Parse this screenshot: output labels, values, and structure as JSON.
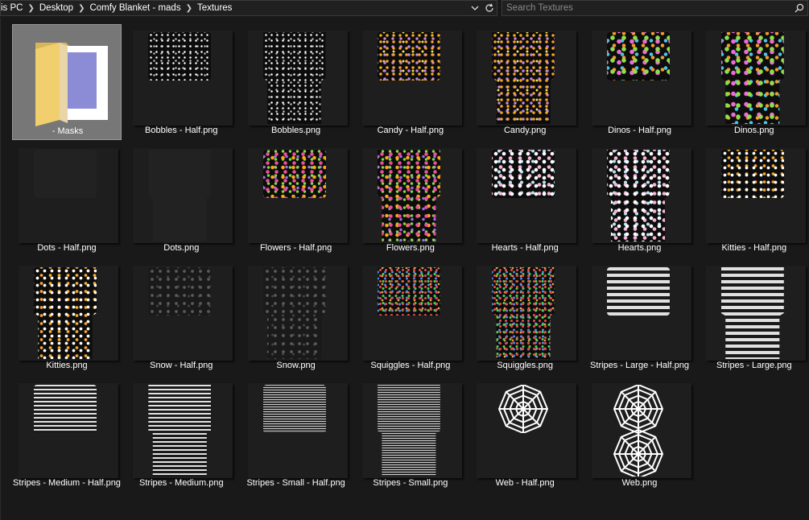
{
  "breadcrumb": [
    "is PC",
    "Desktop",
    "Comfy Blanket - mads",
    "Textures"
  ],
  "search": {
    "placeholder": "Search Textures"
  },
  "colors": {
    "background": "#191919",
    "selected_tile": "#777777",
    "text": "#ffffff"
  },
  "files": [
    {
      "name": "- Masks",
      "kind": "folder",
      "selected": true
    },
    {
      "name": "Bobbles - Half.png",
      "pattern": "bobbles",
      "shape": "half"
    },
    {
      "name": "Bobbles.png",
      "pattern": "bobbles",
      "shape": "full"
    },
    {
      "name": "Candy - Half.png",
      "pattern": "candy",
      "shape": "half"
    },
    {
      "name": "Candy.png",
      "pattern": "candy",
      "shape": "full"
    },
    {
      "name": "Dinos - Half.png",
      "pattern": "dinos",
      "shape": "half"
    },
    {
      "name": "Dinos.png",
      "pattern": "dinos",
      "shape": "full"
    },
    {
      "name": "Dots - Half.png",
      "pattern": "dots",
      "shape": "half"
    },
    {
      "name": "Dots.png",
      "pattern": "dots",
      "shape": "full"
    },
    {
      "name": "Flowers - Half.png",
      "pattern": "flowers",
      "shape": "half"
    },
    {
      "name": "Flowers.png",
      "pattern": "flowers",
      "shape": "full"
    },
    {
      "name": "Hearts - Half.png",
      "pattern": "hearts",
      "shape": "half"
    },
    {
      "name": "Hearts.png",
      "pattern": "hearts",
      "shape": "full"
    },
    {
      "name": "Kitties - Half.png",
      "pattern": "kitties",
      "shape": "half"
    },
    {
      "name": "Kitties.png",
      "pattern": "kitties",
      "shape": "full"
    },
    {
      "name": "Snow - Half.png",
      "pattern": "snow",
      "shape": "half"
    },
    {
      "name": "Snow.png",
      "pattern": "snow",
      "shape": "full"
    },
    {
      "name": "Squiggles - Half.png",
      "pattern": "squiggles",
      "shape": "half"
    },
    {
      "name": "Squiggles.png",
      "pattern": "squiggles",
      "shape": "full"
    },
    {
      "name": "Stripes - Large - Half.png",
      "pattern": "stripes-large",
      "shape": "half"
    },
    {
      "name": "Stripes - Large.png",
      "pattern": "stripes-large",
      "shape": "full"
    },
    {
      "name": "Stripes - Medium - Half.png",
      "pattern": "stripes-medium",
      "shape": "half"
    },
    {
      "name": "Stripes - Medium.png",
      "pattern": "stripes-medium",
      "shape": "full"
    },
    {
      "name": "Stripes - Small - Half.png",
      "pattern": "stripes-small",
      "shape": "half"
    },
    {
      "name": "Stripes - Small.png",
      "pattern": "stripes-small",
      "shape": "full"
    },
    {
      "name": "Web - Half.png",
      "pattern": "web",
      "shape": "half"
    },
    {
      "name": "Web.png",
      "pattern": "web",
      "shape": "full"
    }
  ]
}
